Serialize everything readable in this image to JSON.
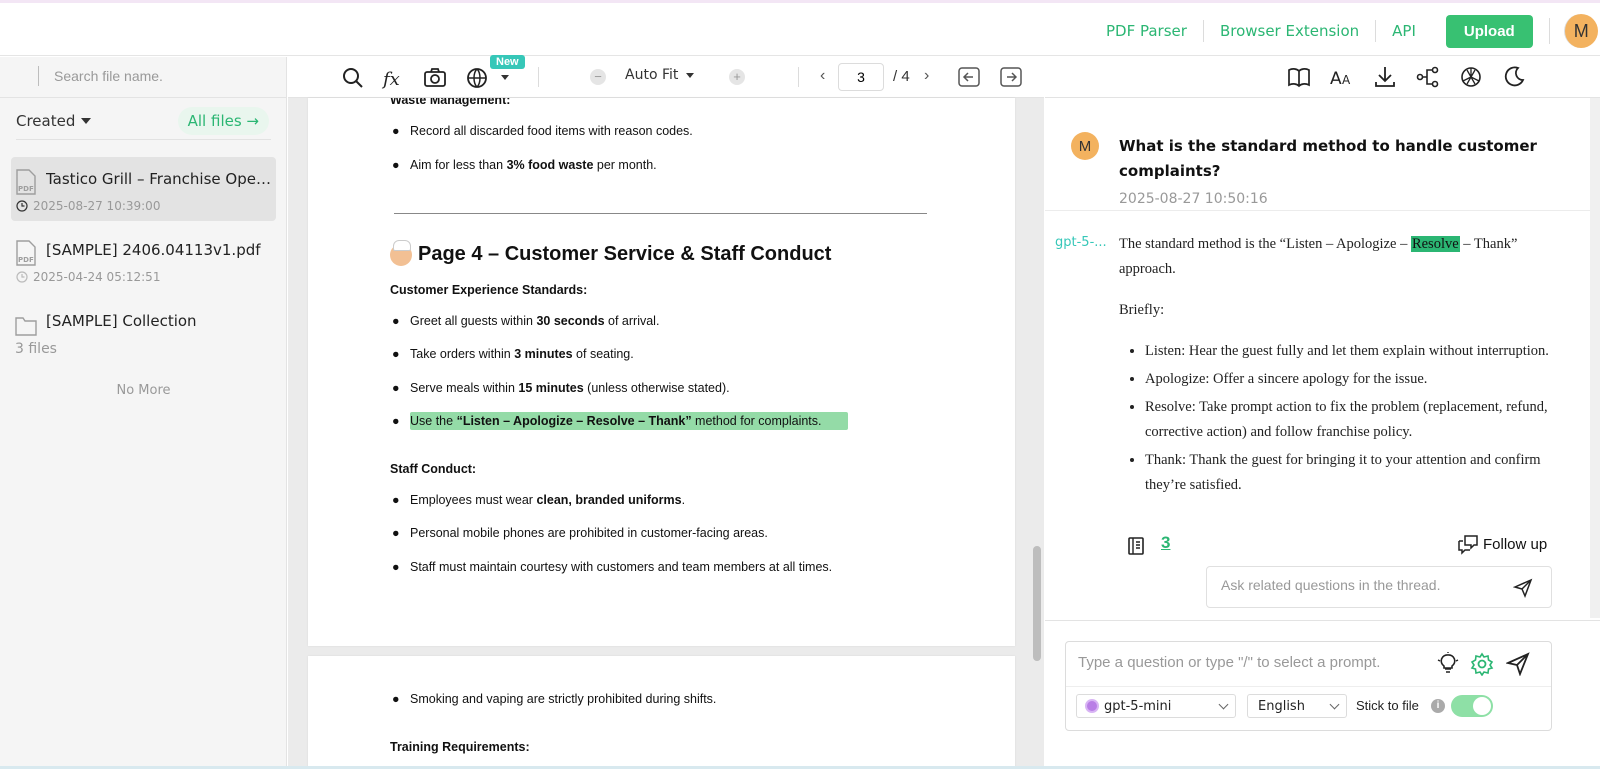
{
  "header": {
    "nav": [
      "PDF Parser",
      "Browser Extension",
      "API"
    ],
    "upload_label": "Upload",
    "avatar_initial": "M"
  },
  "sidebar": {
    "search_placeholder": "Search file name.",
    "sort_label": "Created",
    "all_files_label": "All files →",
    "files": [
      {
        "name": "Tastico Grill – Franchise Oper…",
        "date": "2025-08-27 10:39:00",
        "icon": "pdf-icon"
      },
      {
        "name": "[SAMPLE] 2406.04113v1.pdf",
        "date": "2025-04-24 05:12:51",
        "icon": "pdf-icon"
      },
      {
        "name": "[SAMPLE] Collection",
        "count": "3 files",
        "icon": "folder-icon"
      }
    ],
    "no_more": "No More"
  },
  "viewer": {
    "new_badge": "New",
    "zoom_label": "Auto Fit",
    "page_current": "3",
    "page_total": "/ 4",
    "page1": {
      "section1_heading": "Waste Management:",
      "waste_items": [
        {
          "pre": "Record all discarded food items with reason codes.",
          "bold": "",
          "post": ""
        },
        {
          "pre": "Aim for less than ",
          "bold": "3% food waste",
          "post": " per month."
        }
      ],
      "title": "Page 4 – Customer Service & Staff Conduct",
      "cx_heading": "Customer Experience Standards:",
      "cx_items": [
        {
          "pre": "Greet all guests within ",
          "bold": "30 seconds",
          "post": " of arrival."
        },
        {
          "pre": "Take orders within ",
          "bold": "3 minutes",
          "post": " of seating."
        },
        {
          "pre": "Serve meals within ",
          "bold": "15 minutes",
          "post": " (unless otherwise stated)."
        },
        {
          "pre": "Use the ",
          "bold": "“Listen – Apologize – Resolve – Thank”",
          "post": " method for complaints."
        }
      ],
      "staff_heading": "Staff Conduct:",
      "staff_items": [
        {
          "pre": "Employees must wear ",
          "bold": "clean, branded uniforms",
          "post": "."
        },
        {
          "pre": "Personal mobile phones are prohibited in customer-facing areas.",
          "bold": "",
          "post": ""
        },
        {
          "pre": "Staff must maintain courtesy with customers and team members at all times.",
          "bold": "",
          "post": ""
        }
      ]
    },
    "page2": {
      "item": "Smoking and vaping are strictly prohibited during shifts.",
      "heading": "Training Requirements:"
    }
  },
  "chat": {
    "user_initial": "M",
    "question": "What is the standard method to handle customer complaints?",
    "question_time": "2025-08-27 10:50:16",
    "model_tag": "gpt-5-...",
    "answer_intro_pre": "The standard method is the “Listen – Apologize – ",
    "answer_intro_mark": "Resolve",
    "answer_intro_post": " – Thank” approach.",
    "answer_briefly": "Briefly:",
    "answer_points": [
      "Listen: Hear the guest fully and let them explain without interruption.",
      "Apologize: Offer a sincere apology for the issue.",
      "Resolve: Take prompt action to fix the problem (replacement, refund, corrective action) and follow franchise policy.",
      "Thank: Thank the guest for bringing it to your attention and confirm they’re satisfied."
    ],
    "ref_count": "3",
    "follow_up_label": "Follow up",
    "thread_placeholder": "Ask related questions in the thread.",
    "composer_placeholder": "Type a question or type \"/\" to select a prompt.",
    "model_select": "gpt-5-mini",
    "language_select": "English",
    "stick_label": "Stick to file",
    "stick_enabled": true
  },
  "colors": {
    "accent": "#2bb673",
    "highlight": "#94dba7",
    "avatar": "#f3b25f"
  }
}
